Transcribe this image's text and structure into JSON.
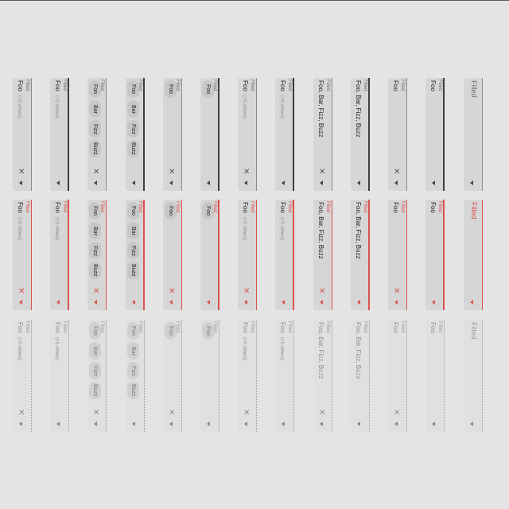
{
  "rows": [
    {
      "state": "default",
      "fields": [
        {
          "variant": "line",
          "label": "Filled",
          "value": "Foo",
          "hint": "(+5 others)",
          "clear": true
        },
        {
          "variant": "focus",
          "label": "Filled",
          "value": "Foo",
          "hint": "(+5 others)",
          "clear": false
        },
        {
          "variant": "line",
          "label": "Filled",
          "chips": [
            "Foo",
            "Bar",
            "Fizz",
            "Buzz"
          ],
          "clear": true
        },
        {
          "variant": "focus",
          "label": "Filled",
          "chips": [
            "Foo",
            "Bar",
            "Fizz",
            "Buzz"
          ],
          "clear": false
        },
        {
          "variant": "line",
          "label": "Filled",
          "chips": [
            "Foo"
          ],
          "clear": true
        },
        {
          "variant": "focus",
          "label": "Filled",
          "chips": [
            "Foo"
          ],
          "clear": false
        },
        {
          "variant": "line",
          "label": "Filled",
          "value": "Foo",
          "hint": "(+5 others)",
          "clear": true
        },
        {
          "variant": "focus",
          "label": "Filled",
          "value": "Foo",
          "hint": "(+5 others)",
          "clear": false
        },
        {
          "variant": "line",
          "label": "Filled",
          "value": "Foo, Bar, Fizz, Buzz",
          "clear": true
        },
        {
          "variant": "focus",
          "label": "Filled",
          "value": "Foo, Bar, Fizz, Buzz",
          "clear": false
        },
        {
          "variant": "line",
          "label": "Filled",
          "value": "Foo",
          "clear": true
        },
        {
          "variant": "focus",
          "label": "Filled",
          "value": "Foo",
          "clear": false
        },
        {
          "variant": "empty",
          "label": "Filled",
          "clear": false
        }
      ]
    },
    {
      "state": "error",
      "fields": [
        {
          "variant": "line",
          "label": "Filled",
          "value": "Foo",
          "hint": "(+5 others)",
          "clear": true
        },
        {
          "variant": "focus",
          "label": "Filled",
          "value": "Foo",
          "hint": "(+5 others)",
          "clear": false
        },
        {
          "variant": "line",
          "label": "Filled",
          "chips": [
            "Foo",
            "Bar",
            "Fizz",
            "Buzz"
          ],
          "clear": true
        },
        {
          "variant": "focus",
          "label": "Filled",
          "chips": [
            "Foo",
            "Bar",
            "Fizz",
            "Buzz"
          ],
          "clear": false
        },
        {
          "variant": "line",
          "label": "Filled",
          "chips": [
            "Foo"
          ],
          "clear": true
        },
        {
          "variant": "focus",
          "label": "Filled",
          "chips": [
            "Foo"
          ],
          "clear": false
        },
        {
          "variant": "line",
          "label": "Filled",
          "value": "Foo",
          "hint": "(+5 others)",
          "clear": true
        },
        {
          "variant": "focus",
          "label": "Filled",
          "value": "Foo",
          "hint": "(+5 others)",
          "clear": false
        },
        {
          "variant": "line",
          "label": "Filled",
          "value": "Foo, Bar, Fizz, Buzz",
          "clear": true
        },
        {
          "variant": "focus",
          "label": "Filled",
          "value": "Foo, Bar, Fizz, Buzz",
          "clear": false
        },
        {
          "variant": "line",
          "label": "Filled",
          "value": "Foo",
          "clear": true
        },
        {
          "variant": "focus",
          "label": "Filled",
          "value": "Foo",
          "clear": false
        },
        {
          "variant": "empty",
          "label": "Filled",
          "clear": false
        }
      ]
    },
    {
      "state": "disabled",
      "fields": [
        {
          "variant": "line",
          "label": "Filled",
          "value": "Foo",
          "hint": "(+5 others)",
          "clear": true
        },
        {
          "variant": "focus",
          "label": "Filled",
          "value": "Foo",
          "hint": "(+5 others)",
          "clear": false
        },
        {
          "variant": "line",
          "label": "Filled",
          "chips": [
            "Foo",
            "Bar",
            "Fizz",
            "Buzz"
          ],
          "clear": true
        },
        {
          "variant": "focus",
          "label": "Filled",
          "chips": [
            "Foo",
            "Bar",
            "Fizz",
            "Buzz"
          ],
          "clear": false
        },
        {
          "variant": "line",
          "label": "Filled",
          "chips": [
            "Foo"
          ],
          "clear": true
        },
        {
          "variant": "focus",
          "label": "Filled",
          "chips": [
            "Foo"
          ],
          "clear": false
        },
        {
          "variant": "line",
          "label": "Filled",
          "value": "Foo",
          "hint": "(+5 others)",
          "clear": true
        },
        {
          "variant": "focus",
          "label": "Filled",
          "value": "Foo",
          "hint": "(+5 others)",
          "clear": false
        },
        {
          "variant": "line",
          "label": "Filled",
          "value": "Foo, Bar, Fizz, Buzz",
          "clear": true
        },
        {
          "variant": "focus",
          "label": "Filled",
          "value": "Foo, Bar, Fizz, Buzz",
          "clear": false
        },
        {
          "variant": "line",
          "label": "Filled",
          "value": "Foo",
          "clear": true
        },
        {
          "variant": "focus",
          "label": "Filled",
          "value": "Foo",
          "clear": false
        },
        {
          "variant": "empty",
          "label": "Filled",
          "clear": false
        }
      ]
    }
  ],
  "icons": {
    "clear": "close-icon",
    "dropdown": "dropdown-arrow-icon"
  },
  "colors": {
    "error": "#d9534f",
    "background": "#e4e4e4",
    "field": "#d6d6d6"
  },
  "glyphs": {
    "clear": "✕"
  }
}
